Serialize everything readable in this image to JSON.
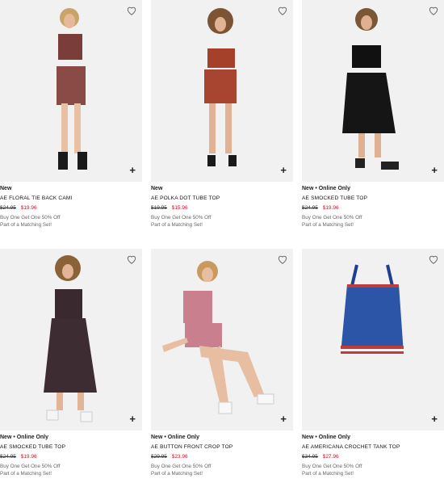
{
  "colors": {
    "sale": "#d0112b",
    "tile_bg": "#f1f1f1"
  },
  "products": [
    {
      "badge": "New",
      "name": "AE FLORAL TIE BACK CAMI",
      "old_price": "$24.95",
      "price": "$19.96",
      "promo": "Buy One Get One 50% Off",
      "match": "Part of a Matching Set!",
      "icon": "heart-icon"
    },
    {
      "badge": "New",
      "name": "AE POLKA DOT TUBE TOP",
      "old_price": "$19.95",
      "price": "$15.96",
      "promo": "Buy One Get One 50% Off",
      "match": "Part of a Matching Set!",
      "icon": "heart-icon"
    },
    {
      "badge": "New • Online Only",
      "name": "AE SMOCKED TUBE TOP",
      "old_price": "$24.95",
      "price": "$19.96",
      "promo": "Buy One Get One 50% Off",
      "match": "Part of a Matching Set!",
      "icon": "heart-icon"
    },
    {
      "badge": "New • Online Only",
      "name": "AE SMOCKED TUBE TOP",
      "old_price": "$24.95",
      "price": "$19.96",
      "promo": "Buy One Get One 50% Off",
      "match": "Part of a Matching Set!",
      "icon": "heart-icon"
    },
    {
      "badge": "New • Online Only",
      "name": "AE BUTTON FRONT CROP TOP",
      "old_price": "$29.95",
      "price": "$23.96",
      "promo": "Buy One Get One 50% Off",
      "match": "Part of a Matching Set!",
      "icon": "heart-icon"
    },
    {
      "badge": "New • Online Only",
      "name": "AE AMERICANA CROCHET TANK TOP",
      "old_price": "$34.95",
      "price": "$27.96",
      "promo": "Buy One Get One 50% Off",
      "match": "Part of a Matching Set!",
      "icon": "heart-icon"
    }
  ],
  "quick_add_symbol": "+"
}
